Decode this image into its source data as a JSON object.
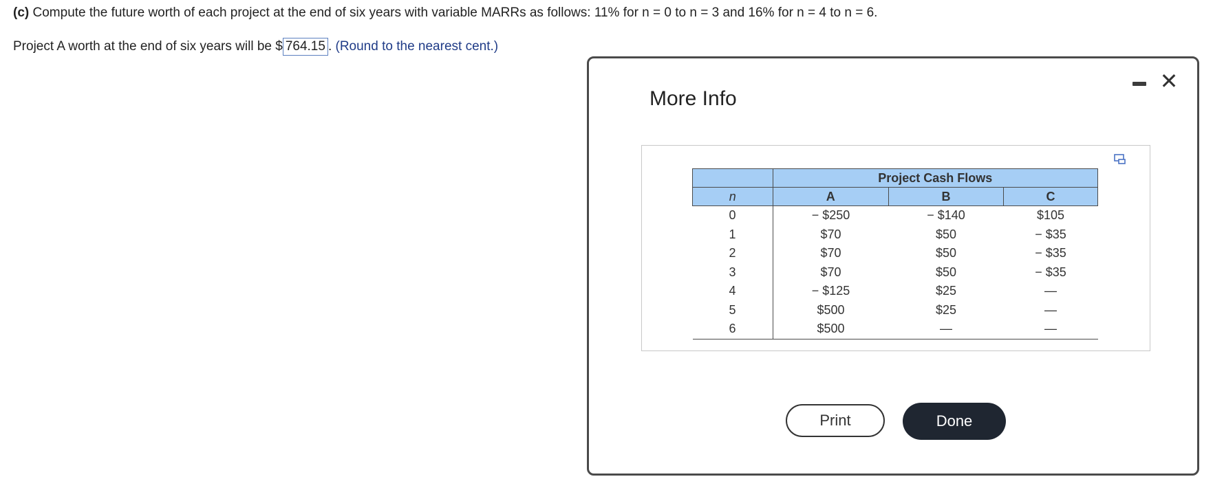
{
  "question": {
    "part_label": "(c)",
    "text": "Compute the future worth of each project at the end of six years with variable MARRs as follows: 11% for n = 0 to n = 3 and 16% for n = 4 to n = 6."
  },
  "answer": {
    "prefix": "Project A worth at the end of six years will be $",
    "value": "764.15",
    "suffix": ".",
    "hint": "(Round to the nearest cent.)"
  },
  "modal": {
    "title": "More Info",
    "minimize_icon": "minimize-icon",
    "close_icon": "close-icon",
    "close_glyph": "✕",
    "copy_icon": "copy-icon",
    "table": {
      "group_header": "Project Cash Flows",
      "columns": [
        "n",
        "A",
        "B",
        "C"
      ],
      "rows": [
        [
          "0",
          "− $250",
          "− $140",
          "$105"
        ],
        [
          "1",
          "$70",
          "$50",
          "− $35"
        ],
        [
          "2",
          "$70",
          "$50",
          "− $35"
        ],
        [
          "3",
          "$70",
          "$50",
          "− $35"
        ],
        [
          "4",
          "− $125",
          "$25",
          "—"
        ],
        [
          "5",
          "$500",
          "$25",
          "—"
        ],
        [
          "6",
          "$500",
          "—",
          "—"
        ]
      ]
    },
    "print_label": "Print",
    "done_label": "Done"
  }
}
